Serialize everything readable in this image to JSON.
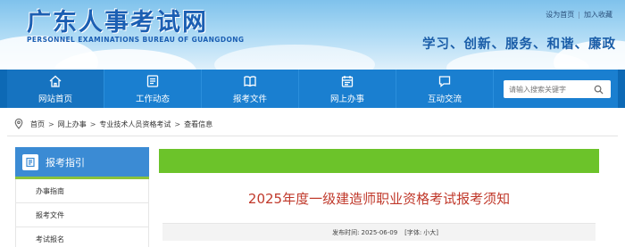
{
  "header": {
    "site_title": "广东人事考试网",
    "site_subtitle": "PERSONNEL EXAMINATIONS BUREAU OF GUANGDONG",
    "top_links": [
      "设为首页",
      "加入收藏"
    ],
    "top_link_sep": "|",
    "slogan": "学习、创新、服务、和谐、廉政"
  },
  "nav": {
    "items": [
      {
        "label": "网站首页",
        "icon": "home-icon"
      },
      {
        "label": "工作动态",
        "icon": "document-list-icon"
      },
      {
        "label": "报考文件",
        "icon": "book-icon"
      },
      {
        "label": "网上办事",
        "icon": "calendar-icon"
      },
      {
        "label": "互动交流",
        "icon": "chat-icon"
      }
    ],
    "search": {
      "placeholder": "请输入搜索关键字",
      "icon": "search-icon"
    }
  },
  "breadcrumb": {
    "icon": "location-pin-icon",
    "items": [
      "首页",
      "网上办事",
      "专业技术人员资格考试",
      "查看信息"
    ],
    "sep": ">"
  },
  "sidebar": {
    "title": "报考指引",
    "icon": "guide-icon",
    "items": [
      "办事指南",
      "报考文件",
      "考试报名"
    ]
  },
  "article": {
    "title": "2025年度一级建造师职业资格考试报考须知",
    "publish_label": "发布时间:",
    "publish_date": "2025-06-09",
    "font_label": "[字体:",
    "font_size": "小大]"
  },
  "colors": {
    "nav_bg": "#1a7fd0",
    "accent_green": "#6cc32a",
    "title_red": "#c0392b",
    "logo_blue": "#1b5fb3"
  }
}
